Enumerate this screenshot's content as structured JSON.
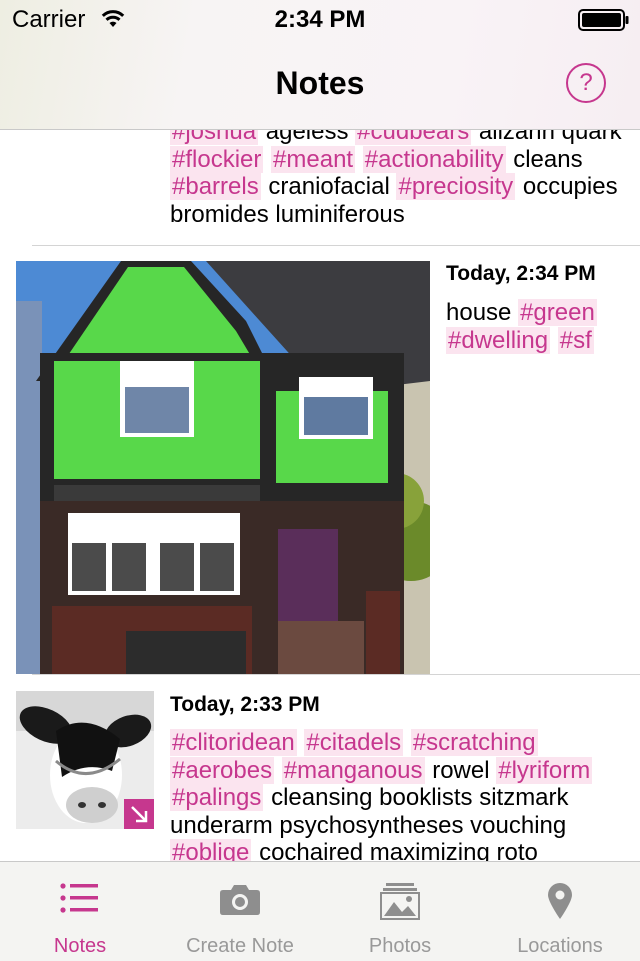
{
  "status_bar": {
    "carrier": "Carrier",
    "time": "2:34 PM"
  },
  "nav": {
    "title": "Notes",
    "help_label": "?"
  },
  "colors": {
    "accent": "#c6378e",
    "tag_background": "#fbe4ef",
    "inactive": "#999999"
  },
  "notes": [
    {
      "partial": true,
      "lines": [
        [
          {
            "t": "#joshua",
            "tag": true
          },
          {
            "t": "ageless"
          },
          {
            "t": "#cudbears",
            "tag": true
          },
          {
            "t": "alizarin quark"
          }
        ],
        [
          {
            "t": "#flockier",
            "tag": true
          },
          {
            "t": "#meant",
            "tag": true
          },
          {
            "t": "#actionability",
            "tag": true
          },
          {
            "t": "cleans"
          }
        ],
        [
          {
            "t": "#barrels",
            "tag": true
          },
          {
            "t": "craniofacial"
          },
          {
            "t": "#preciosity",
            "tag": true
          },
          {
            "t": "occupies"
          }
        ],
        [
          {
            "t": "bromides luminiferous"
          }
        ]
      ]
    },
    {
      "timestamp": "Today, 2:34 PM",
      "image": "green-house-photo",
      "lines": [
        [
          {
            "t": "house"
          },
          {
            "t": "#green",
            "tag": true
          }
        ],
        [
          {
            "t": "#dwelling",
            "tag": true
          },
          {
            "t": "#sf",
            "tag": true
          }
        ]
      ]
    },
    {
      "timestamp": "Today, 2:33 PM",
      "image": "cow-photo-thumbnail",
      "badge_icon": "expand-arrow-icon",
      "lines": [
        [
          {
            "t": "#clitoridean",
            "tag": true
          },
          {
            "t": "#citadels",
            "tag": true
          },
          {
            "t": "#scratching",
            "tag": true
          }
        ],
        [
          {
            "t": "#aerobes",
            "tag": true
          },
          {
            "t": "#manganous",
            "tag": true
          },
          {
            "t": "rowel"
          },
          {
            "t": "#lyriform",
            "tag": true
          }
        ],
        [
          {
            "t": "#palings",
            "tag": true
          },
          {
            "t": "cleansing booklists sitzmark"
          }
        ],
        [
          {
            "t": "underarm psychosyntheses vouching"
          }
        ],
        [
          {
            "t": "#oblige",
            "tag": true
          },
          {
            "t": "cochaired maximizing roto"
          }
        ]
      ]
    }
  ],
  "tabs": [
    {
      "label": "Notes",
      "icon": "list-icon",
      "active": true
    },
    {
      "label": "Create Note",
      "icon": "camera-icon",
      "active": false
    },
    {
      "label": "Photos",
      "icon": "photos-icon",
      "active": false
    },
    {
      "label": "Locations",
      "icon": "location-pin-icon",
      "active": false
    }
  ]
}
